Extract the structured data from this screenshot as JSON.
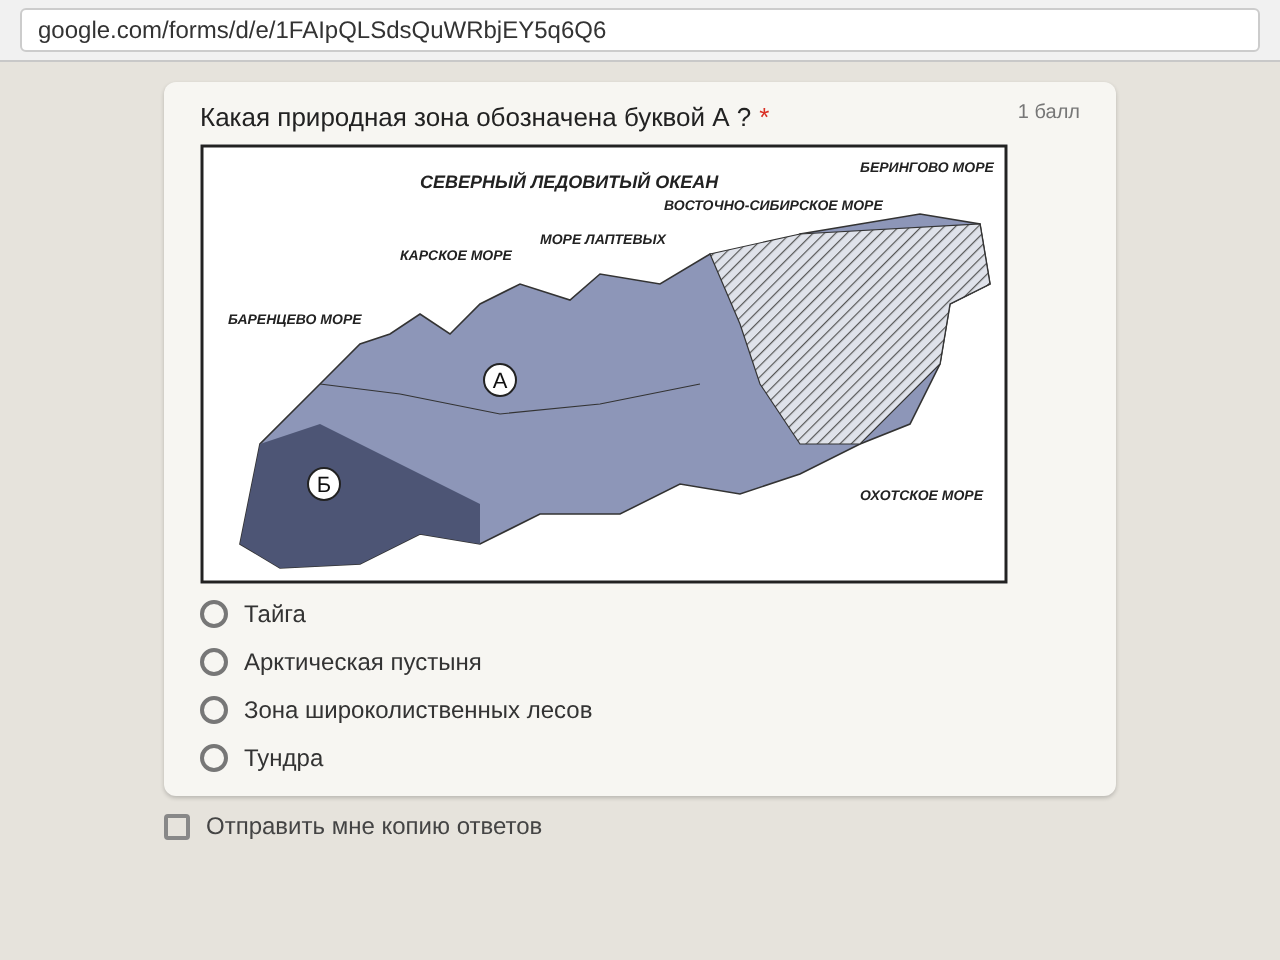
{
  "browser": {
    "address": "google.com/forms/d/e/1FAIpQLSdsQuWRbjEY5q6Q6"
  },
  "question": {
    "points": "1 балл",
    "title": "Какая природная зона обозначена буквой А ?",
    "required_mark": "*",
    "map": {
      "labels": [
        {
          "text": "СЕВЕРНЫЙ ЛЕДОВИТЫЙ ОКЕАН",
          "kind": "ocean"
        },
        {
          "text": "БАРЕНЦЕВО МОРЕ",
          "kind": "sea"
        },
        {
          "text": "КАРСКОЕ МОРЕ",
          "kind": "sea"
        },
        {
          "text": "МОРЕ ЛАПТЕВЫХ",
          "kind": "sea"
        },
        {
          "text": "ВОСТОЧНО-СИБИРСКОЕ МОРЕ",
          "kind": "sea"
        },
        {
          "text": "БЕРИНГОВО МОРЕ",
          "kind": "sea"
        },
        {
          "text": "ОХОТСКОЕ МОРЕ",
          "kind": "sea"
        }
      ],
      "markers": [
        {
          "text": "А"
        },
        {
          "text": "Б"
        }
      ]
    },
    "options": [
      {
        "label": "Тайга",
        "selected": false
      },
      {
        "label": "Арктическая пустыня",
        "selected": false
      },
      {
        "label": "Зона широколиственных лесов",
        "selected": false
      },
      {
        "label": "Тундра",
        "selected": false
      }
    ]
  },
  "send_copy": {
    "label": "Отправить мне копию ответов",
    "checked": false
  }
}
